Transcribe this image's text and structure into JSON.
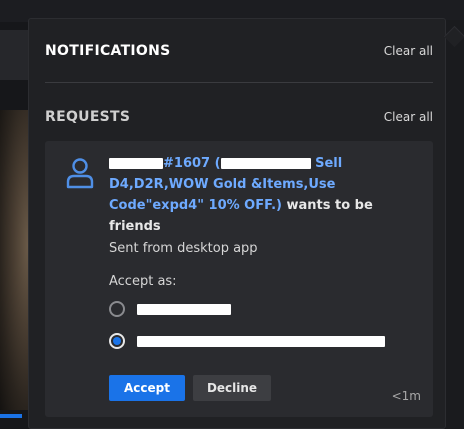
{
  "notifications": {
    "title": "NOTIFICATIONS",
    "clear_all_label": "Clear all"
  },
  "requests": {
    "title": "REQUESTS",
    "clear_all_label": "Clear all",
    "items": [
      {
        "username_suffix": "#1607 (",
        "display_tail": "Sell D4,D2R,WOW Gold &Items,Use Code\"expd4\" 10% OFF.)",
        "action_text": " wants to be friends",
        "sent_from": "Sent from desktop app",
        "accept_as_label": "Accept as:",
        "options": [
          {
            "label": "",
            "selected": false
          },
          {
            "label": "",
            "selected": true
          }
        ],
        "accept_label": "Accept",
        "decline_label": "Decline",
        "time": "<1m"
      }
    ]
  },
  "colors": {
    "accent": "#1a73e8",
    "link": "#6eaaff",
    "panel_bg": "#202124",
    "card_bg": "#2a2b2f"
  },
  "icons": {
    "avatar": "user-icon"
  }
}
